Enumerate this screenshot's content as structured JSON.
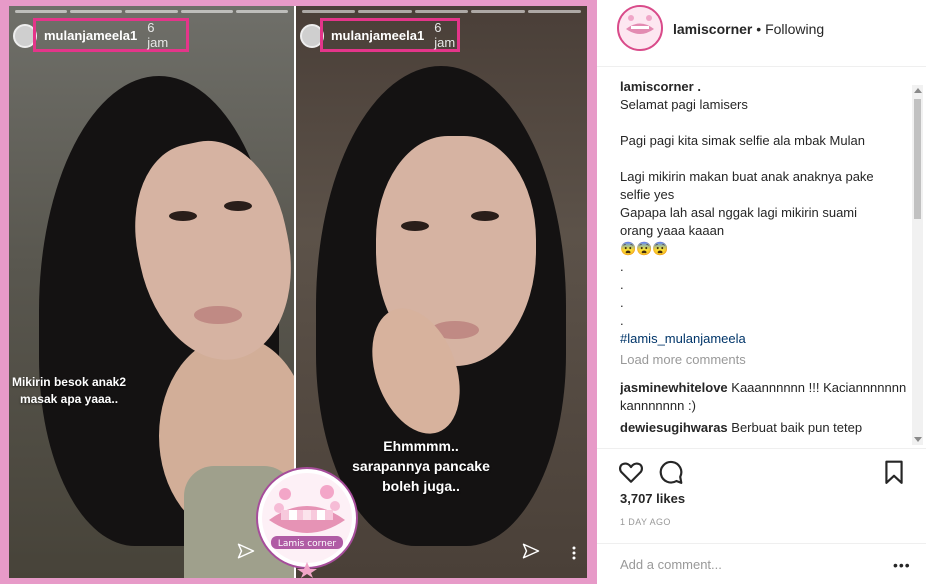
{
  "colors": {
    "frame_pink": "#e79ac8",
    "highlight_box": "#e4358a",
    "link": "#003569"
  },
  "story_left": {
    "username": "mulanjameela1",
    "time": "6 jam",
    "caption_lines": [
      "Mikirin besok anak2",
      "masak apa yaaa.."
    ]
  },
  "story_right": {
    "username": "mulanjameela1",
    "time": "6 jam",
    "caption_lines": [
      "Ehmmmm..",
      "sarapannya pancake",
      "boleh juga.."
    ]
  },
  "logo": {
    "text": "Lamis corner"
  },
  "post": {
    "author": "lamiscorner",
    "separator": "•",
    "follow_state": "Following",
    "caption_lines": [
      "lamiscorner .",
      "Selamat pagi lamisers",
      "",
      "Pagi pagi kita simak selfie ala mbak Mulan",
      "",
      "Lagi mikirin makan buat anak anaknya pake",
      "selfie yes",
      "Gapapa lah asal nggak lagi mikirin suami",
      "orang yaaa kaaan",
      "😨😨😨",
      ".",
      ".",
      ".",
      "."
    ],
    "hashtag": "#lamis_mulanjameela",
    "load_more": "Load more comments",
    "comments": [
      {
        "user": "jasminewhitelove",
        "text": "Kaaannnnnn !!! Kaciannnnnnn kannnnnnn :)"
      },
      {
        "user": "dewiesugihwaras",
        "text": "Berbuat baik pun tetep"
      }
    ],
    "likes": "3,707 likes",
    "posted": "1 DAY AGO",
    "add_comment_placeholder": "Add a comment...",
    "more_glyph": "•••"
  },
  "icons": [
    "heart-icon",
    "comment-icon",
    "bookmark-icon",
    "send-icon",
    "more-icon"
  ]
}
